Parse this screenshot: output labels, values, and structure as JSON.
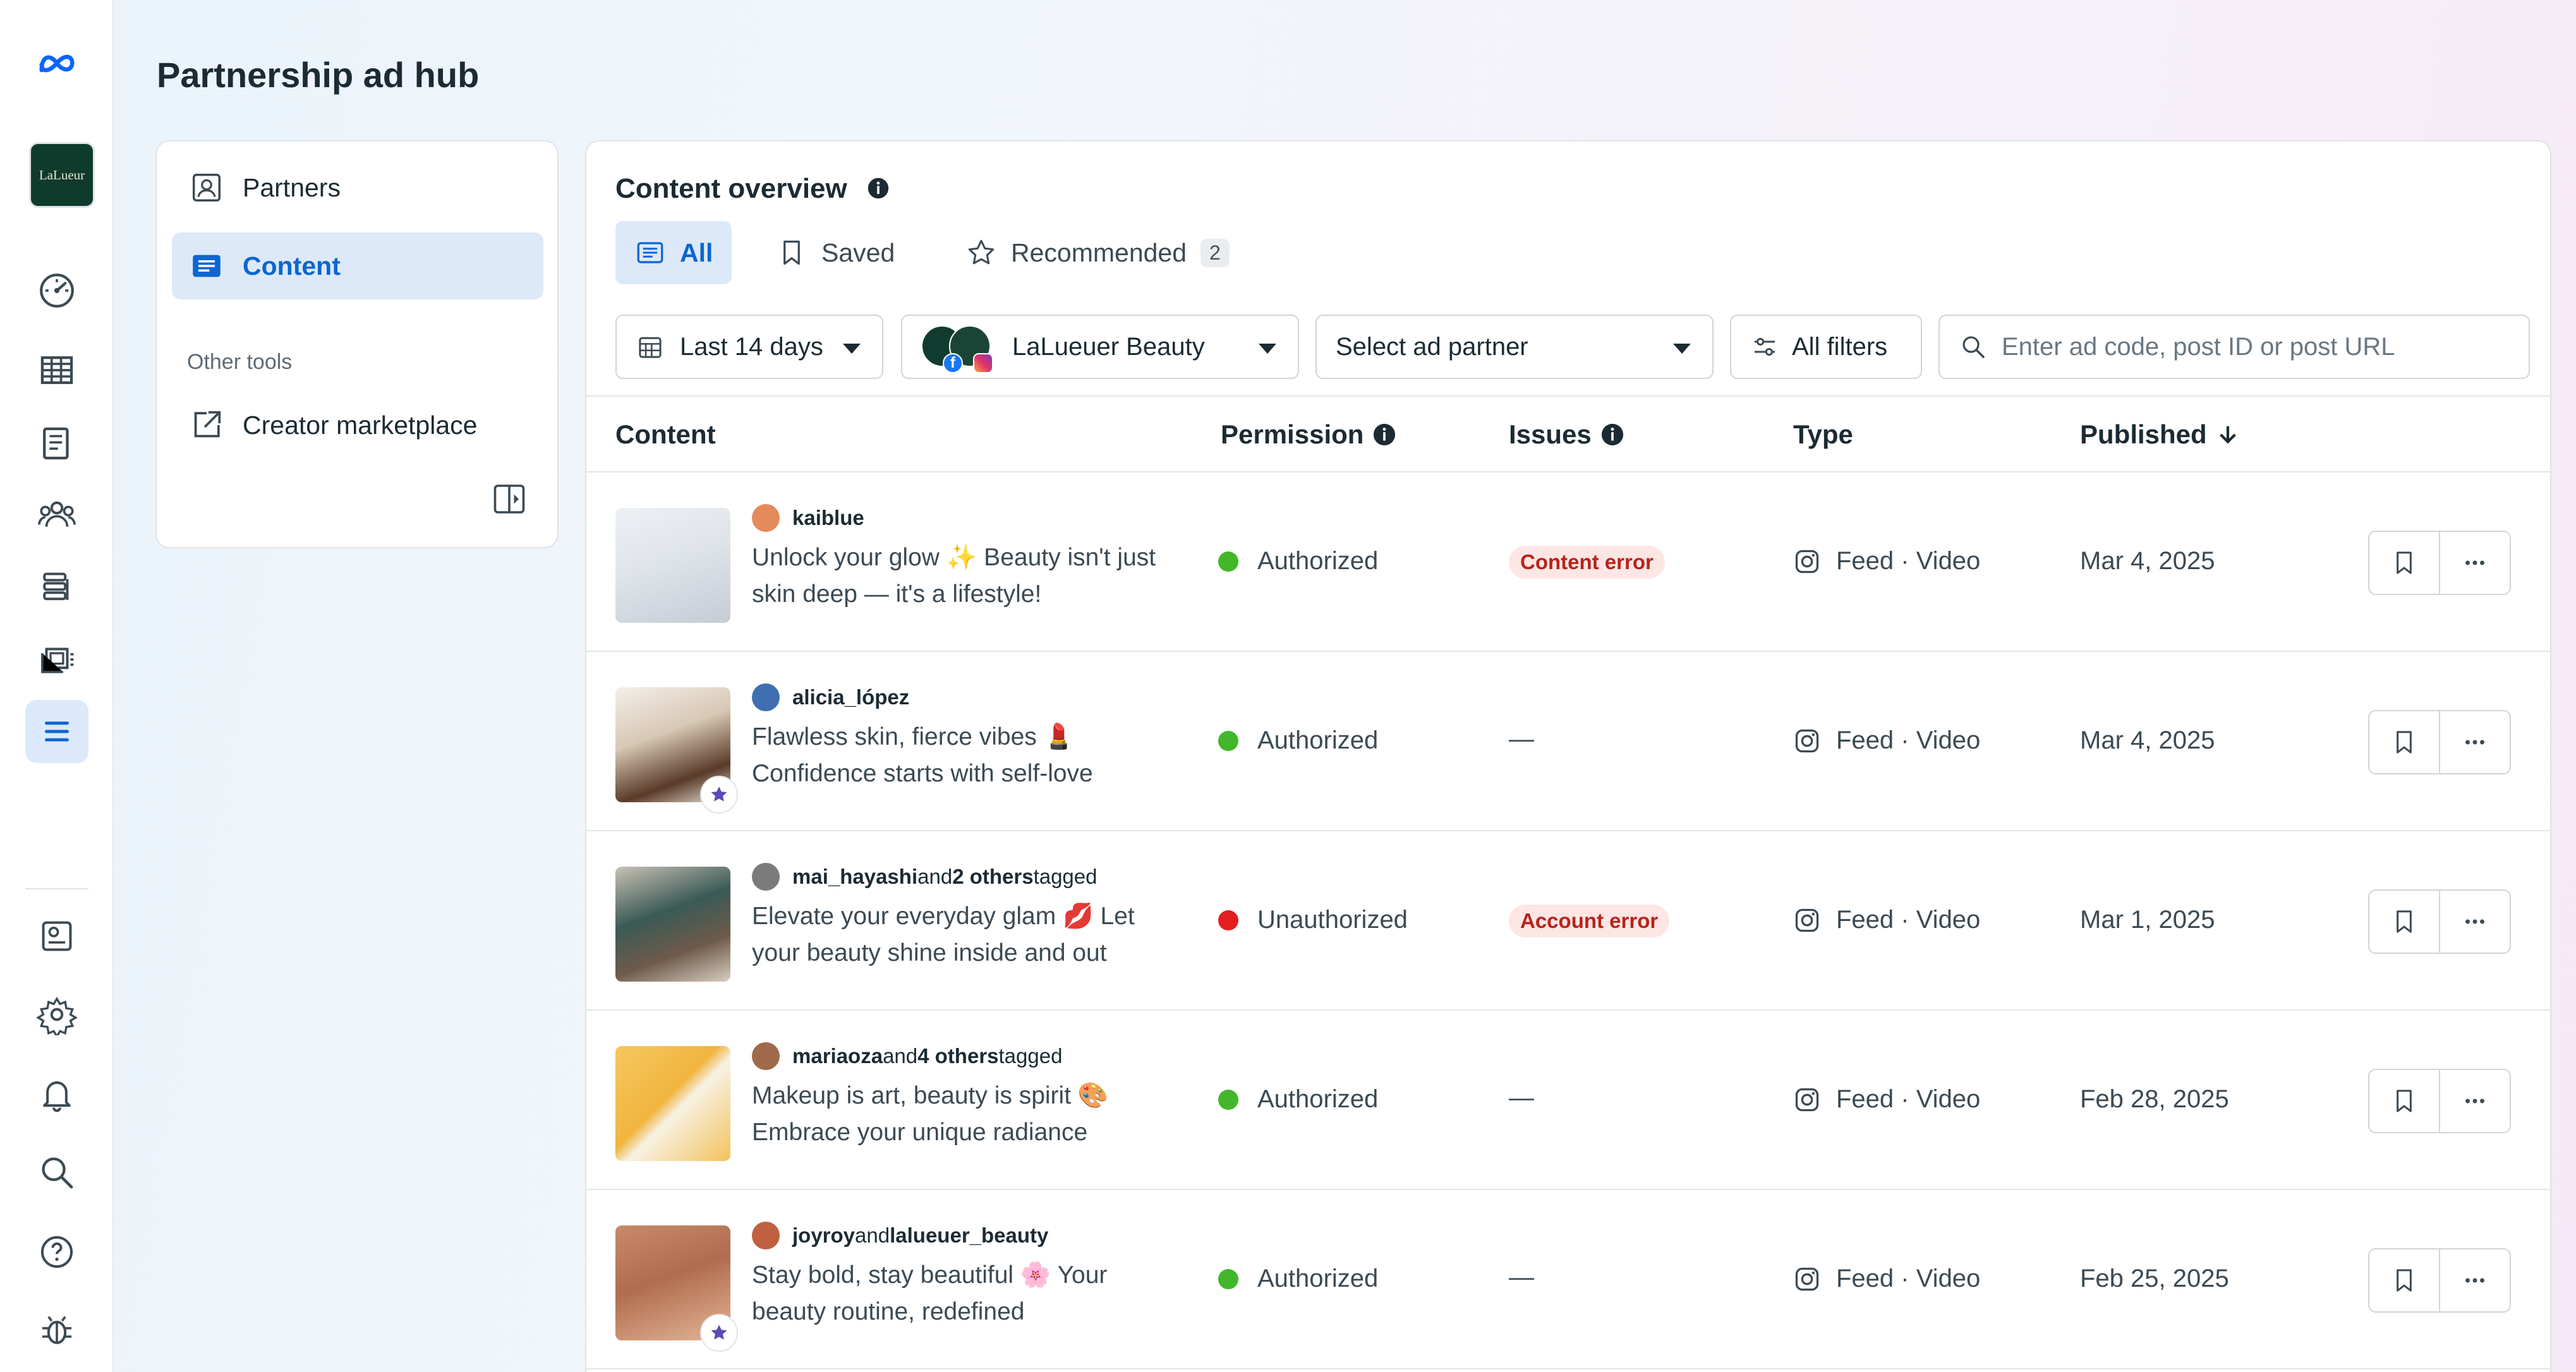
{
  "app": {
    "title": "Partnership ad hub",
    "brand_logo_text": "LaLueur"
  },
  "rail": {
    "items": [
      "meta-logo",
      "brand-account",
      "dashboard",
      "table",
      "pages",
      "audience",
      "database",
      "ads-library",
      "content-list",
      "ad-preview",
      "settings",
      "notifications",
      "search",
      "help",
      "bug-report"
    ]
  },
  "nav": {
    "partners": "Partners",
    "content": "Content",
    "other_tools": "Other tools",
    "creator_marketplace": "Creator marketplace"
  },
  "overview": {
    "title": "Content overview",
    "tabs": [
      {
        "label": "All",
        "active": true
      },
      {
        "label": "Saved",
        "active": false
      },
      {
        "label": "Recommended",
        "count": "2",
        "active": false
      }
    ]
  },
  "filters": {
    "date": "Last 14 days",
    "account": "LaLueuer Beauty",
    "partner": "Select ad partner",
    "all_filters": "All filters",
    "search_placeholder": "Enter ad code, post ID or post URL"
  },
  "table": {
    "headers": {
      "content": "Content",
      "permission": "Permission",
      "issues": "Issues",
      "type": "Type",
      "published": "Published"
    },
    "rows": [
      {
        "author": "kaiblue",
        "tagged_text": "",
        "tagged_extra": "",
        "tagged_suffix": "",
        "caption": "Unlock your glow ✨ Beauty isn't just skin deep — it's a lifestyle!",
        "permission": "Authorized",
        "permission_color": "#42b72a",
        "issue": "Content error",
        "type": "Feed · Video",
        "published": "Mar 4, 2025",
        "starred": false
      },
      {
        "author": "alicia_lópez",
        "tagged_text": "",
        "tagged_extra": "",
        "tagged_suffix": "",
        "caption": "Flawless skin, fierce vibes 💄 Confidence starts with self-love",
        "permission": "Authorized",
        "permission_color": "#42b72a",
        "issue": "—",
        "type": "Feed · Video",
        "published": "Mar 4, 2025",
        "starred": true
      },
      {
        "author": "mai_hayashi",
        "tagged_text": " and ",
        "tagged_extra": "2 others",
        "tagged_suffix": " tagged",
        "caption": "Elevate your everyday glam 💋 Let your beauty shine inside and out",
        "permission": "Unauthorized",
        "permission_color": "#e41e1e",
        "issue": "Account error",
        "type": "Feed · Video",
        "published": "Mar 1, 2025",
        "starred": false
      },
      {
        "author": "mariaoza",
        "tagged_text": " and ",
        "tagged_extra": "4 others",
        "tagged_suffix": " tagged",
        "caption": "Makeup is art, beauty is spirit 🎨 Embrace your unique radiance",
        "permission": "Authorized",
        "permission_color": "#42b72a",
        "issue": "—",
        "type": "Feed · Video",
        "published": "Feb 28, 2025",
        "starred": false
      },
      {
        "author": "joyroy",
        "tagged_text": " and ",
        "tagged_extra": "lalueuer_beauty",
        "tagged_suffix": "",
        "caption": "Stay bold, stay beautiful 🌸 Your beauty routine, redefined",
        "permission": "Authorized",
        "permission_color": "#42b72a",
        "issue": "—",
        "type": "Feed · Video",
        "published": "Feb 25, 2025",
        "starred": true
      }
    ]
  },
  "colors": {
    "accent": "#0a66d2",
    "authorized": "#42b72a",
    "unauthorized": "#e41e1e",
    "error_bg": "#fde6e4",
    "error_text": "#b8231a"
  }
}
